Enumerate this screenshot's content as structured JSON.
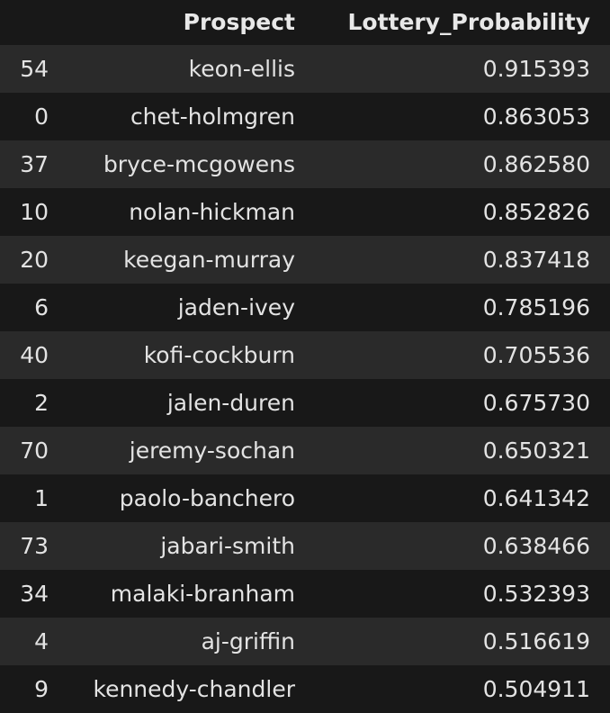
{
  "table": {
    "columns": [
      "",
      "Prospect",
      "Lottery_Probability"
    ],
    "rows": [
      {
        "index": "54",
        "prospect": "keon-ellis",
        "probability": "0.915393"
      },
      {
        "index": "0",
        "prospect": "chet-holmgren",
        "probability": "0.863053"
      },
      {
        "index": "37",
        "prospect": "bryce-mcgowens",
        "probability": "0.862580"
      },
      {
        "index": "10",
        "prospect": "nolan-hickman",
        "probability": "0.852826"
      },
      {
        "index": "20",
        "prospect": "keegan-murray",
        "probability": "0.837418"
      },
      {
        "index": "6",
        "prospect": "jaden-ivey",
        "probability": "0.785196"
      },
      {
        "index": "40",
        "prospect": "kofi-cockburn",
        "probability": "0.705536"
      },
      {
        "index": "2",
        "prospect": "jalen-duren",
        "probability": "0.675730"
      },
      {
        "index": "70",
        "prospect": "jeremy-sochan",
        "probability": "0.650321"
      },
      {
        "index": "1",
        "prospect": "paolo-banchero",
        "probability": "0.641342"
      },
      {
        "index": "73",
        "prospect": "jabari-smith",
        "probability": "0.638466"
      },
      {
        "index": "34",
        "prospect": "malaki-branham",
        "probability": "0.532393"
      },
      {
        "index": "4",
        "prospect": "aj-griffin",
        "probability": "0.516619"
      },
      {
        "index": "9",
        "prospect": "kennedy-chandler",
        "probability": "0.504911"
      }
    ]
  }
}
